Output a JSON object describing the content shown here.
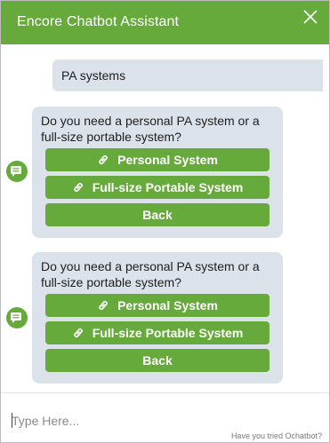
{
  "header": {
    "title": "Encore Chatbot Assistant"
  },
  "colors": {
    "accent": "#67aa3c",
    "bubble": "#dce2ea"
  },
  "messages": {
    "user_message": "PA systems",
    "bot_cards": [
      {
        "question": "Do you need a personal PA system or a full-size portable system?",
        "options": [
          {
            "label": "Personal System",
            "icon": "link-icon"
          },
          {
            "label": "Full-size Portable System",
            "icon": "link-icon"
          },
          {
            "label": "Back"
          }
        ]
      },
      {
        "question": "Do you need a personal PA system or a full-size portable system?",
        "options": [
          {
            "label": "Personal System",
            "icon": "link-icon"
          },
          {
            "label": "Full-size Portable System",
            "icon": "link-icon"
          },
          {
            "label": "Back"
          }
        ]
      }
    ]
  },
  "footer": {
    "input_placeholder": "Type Here...",
    "input_value": "",
    "promo_text": "Have you tried Ochatbot?"
  }
}
